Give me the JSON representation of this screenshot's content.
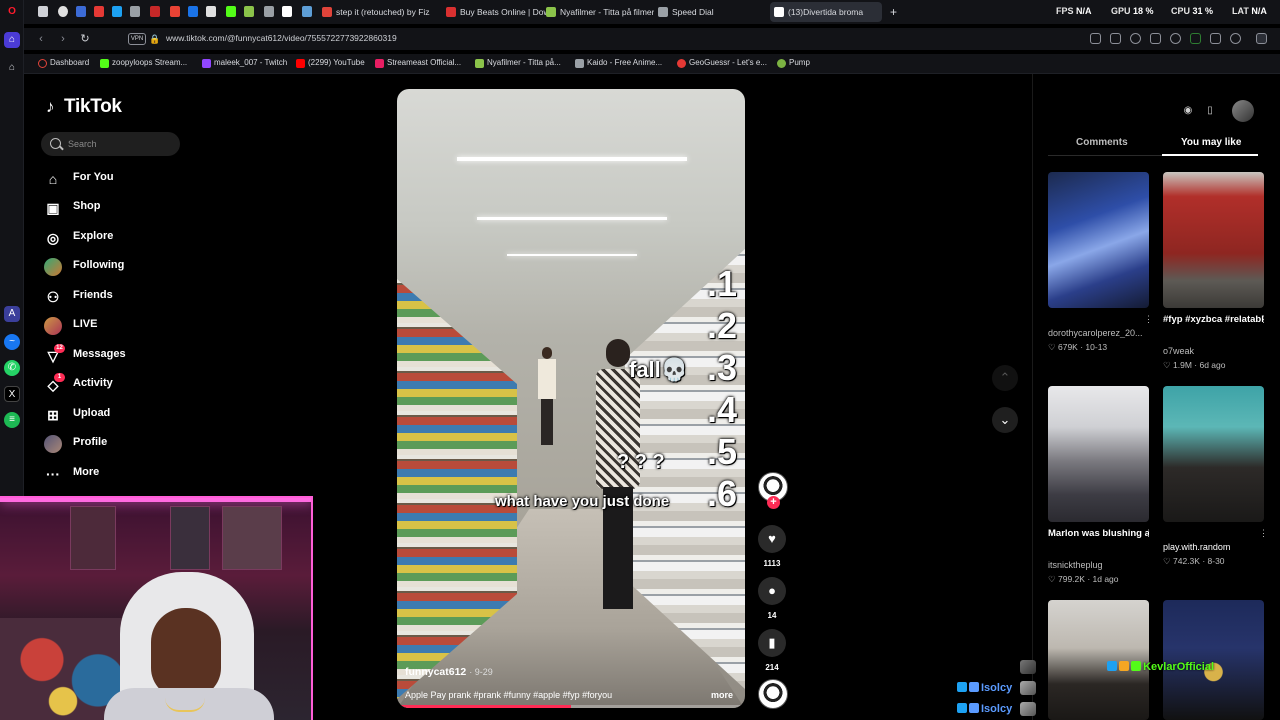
{
  "browser": {
    "tabs": [
      {
        "label": "step it (retouched) by Fizz",
        "color": "#e0443a"
      },
      {
        "label": "Buy Beats Online | Download",
        "color": "#d93030"
      },
      {
        "label": "Nyafilmer - Titta på filmer",
        "color": "#8bc34a"
      },
      {
        "label": "Speed Dial",
        "color": "#9aa0a6"
      },
      {
        "label": "(13)Divertida broma",
        "color": "#ffffff"
      }
    ],
    "hud": {
      "fps_label": "FPS",
      "fps_value": "N/A",
      "gpu_label": "GPU",
      "gpu_value": "18 %",
      "cpu_label": "CPU",
      "cpu_value": "31 %",
      "lat_label": "LAT",
      "lat_value": "N/A"
    },
    "vpn_label": "VPN",
    "url": "www.tiktok.com/@funnycat612/video/7555722773922860319",
    "bookmarks": [
      {
        "label": "Dashboard",
        "color": "#e0443a"
      },
      {
        "label": "zoopyloops Stream...",
        "color": "#53fc18"
      },
      {
        "label": "maleek_007 - Twitch",
        "color": "#9146ff"
      },
      {
        "label": "(2299) YouTube",
        "color": "#ff0000"
      },
      {
        "label": "Streameast Official...",
        "color": "#e91e63"
      },
      {
        "label": "Nyafilmer - Titta på...",
        "color": "#8bc34a"
      },
      {
        "label": "Kaido - Free Anime...",
        "color": "#9aa0a6"
      },
      {
        "label": "GeoGuessr - Let's e...",
        "color": "#e53935"
      },
      {
        "label": "Pump",
        "color": "#7cb342"
      }
    ]
  },
  "sidebar": {
    "logo": "TikTok",
    "search_placeholder": "Search",
    "items": [
      {
        "label": "For You",
        "icon": "home-icon"
      },
      {
        "label": "Shop",
        "icon": "shop-icon"
      },
      {
        "label": "Explore",
        "icon": "compass-icon"
      },
      {
        "label": "Following",
        "icon": "following-avatar"
      },
      {
        "label": "Friends",
        "icon": "friends-icon"
      },
      {
        "label": "LIVE",
        "icon": "live-avatar"
      },
      {
        "label": "Messages",
        "icon": "messages-icon",
        "badge": "12"
      },
      {
        "label": "Activity",
        "icon": "activity-icon",
        "badge": "1"
      },
      {
        "label": "Upload",
        "icon": "upload-icon"
      },
      {
        "label": "Profile",
        "icon": "profile-avatar"
      },
      {
        "label": "More",
        "icon": "more-icon"
      }
    ]
  },
  "video": {
    "overlay_numbers": [
      ".1",
      ".2",
      ".3",
      ".4",
      ".5",
      ".6"
    ],
    "overlay_fall": "fall💀",
    "overlay_question": "? ? ?",
    "overlay_caption": "what have you just done",
    "author": "funnycat612",
    "date": "· 9-29",
    "description": "Apple Pay prank #prank #funny #apple #fyp #foryou",
    "more_label": "more",
    "progress": 0.5
  },
  "actions": {
    "likes": "1113",
    "comments": "14",
    "saves": "214"
  },
  "right_panel": {
    "tabs": [
      "Comments",
      "You may like"
    ],
    "active_tab": "You may like",
    "cards": [
      {
        "title": "",
        "user": "dorothycarolperez_20...",
        "likes": "679K",
        "date": "10-13"
      },
      {
        "title": "#fyp #xyzbca #relatable #funn...",
        "user": "o7weak",
        "likes": "1.9M",
        "date": "6d ago"
      },
      {
        "title": "Marlon was blushing after...",
        "user": "itsnicktheplug",
        "likes": "799.2K",
        "date": "1d ago"
      },
      {
        "title": "",
        "user": "play.with.random",
        "likes": "742.3K",
        "date": "8-30"
      }
    ]
  },
  "chat": [
    {
      "name": "KevlarOfficial",
      "color": "#53fc18"
    },
    {
      "name": "Isolcy",
      "color": "#5b9bff"
    },
    {
      "name": "Isolcy",
      "color": "#5b9bff"
    }
  ]
}
